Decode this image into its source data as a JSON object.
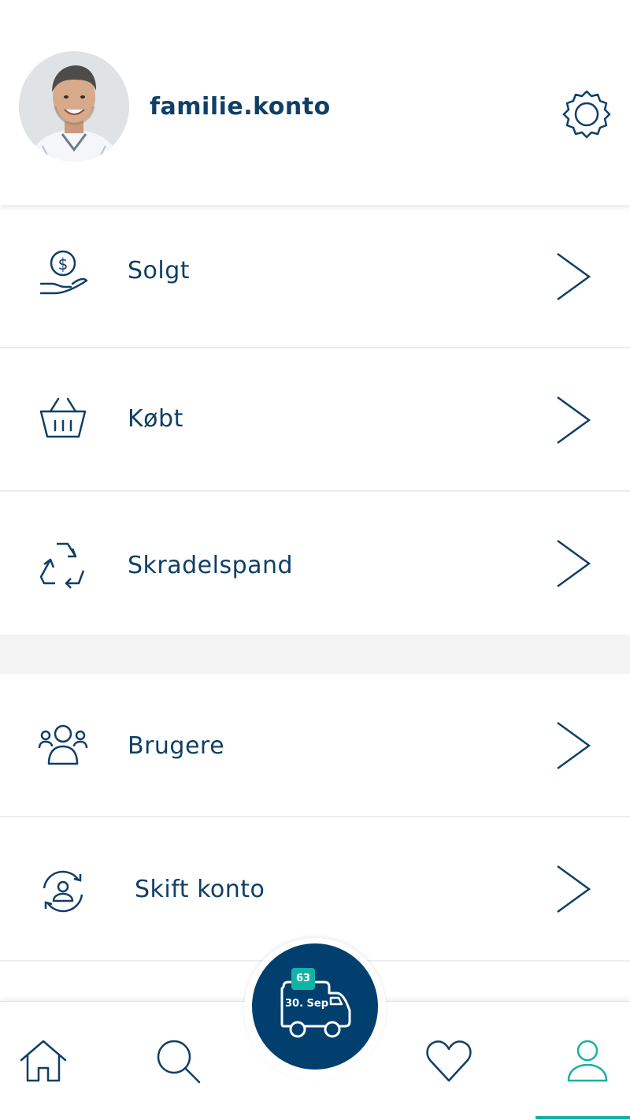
{
  "profile": {
    "username": "familie.konto"
  },
  "menu": {
    "items": [
      {
        "label": "Solgt",
        "icon": "money-hand-icon"
      },
      {
        "label": "Købt",
        "icon": "basket-icon"
      },
      {
        "label": "Skradelspand",
        "icon": "recycle-icon"
      },
      {
        "label": "Brugere",
        "icon": "users-icon"
      },
      {
        "label": "Skift konto",
        "icon": "switch-account-icon"
      }
    ]
  },
  "delivery": {
    "badge_count": "63",
    "date": "30. Sep"
  },
  "tabbar": {
    "tabs": [
      {
        "icon": "home-icon",
        "active": false
      },
      {
        "icon": "search-icon",
        "active": false
      },
      {
        "icon": "heart-icon",
        "active": false
      },
      {
        "icon": "profile-icon",
        "active": true
      }
    ]
  },
  "colors": {
    "primary": "#0f3f66",
    "fab": "#003f6e",
    "accent": "#1ab0a0"
  }
}
